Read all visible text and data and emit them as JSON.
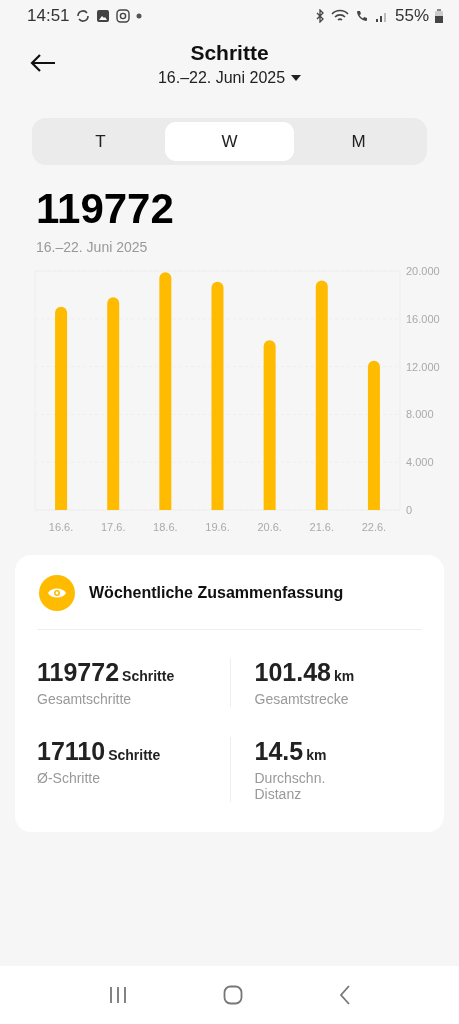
{
  "status_bar": {
    "time": "14:51",
    "battery": "55%"
  },
  "header": {
    "title": "Schritte",
    "period": "16.–22. Juni 2025"
  },
  "tabs": [
    {
      "label": "T",
      "selected": false
    },
    {
      "label": "W",
      "selected": true
    },
    {
      "label": "M",
      "selected": false
    }
  ],
  "total": {
    "value": "119772",
    "period": "16.–22. Juni 2025"
  },
  "chart_data": {
    "type": "bar",
    "categories": [
      "16.6.",
      "17.6.",
      "18.6.",
      "19.6.",
      "20.6.",
      "21.6.",
      "22.6."
    ],
    "series": [
      {
        "color": "#ffbb00",
        "values": [
          17.0,
          17.8,
          19.9,
          19.1,
          14.2,
          19.2,
          12.5
        ]
      }
    ],
    "ylim": [
      0,
      20
    ],
    "grid": true,
    "yticks": [
      {
        "value": 0,
        "label": "0"
      },
      {
        "value": 4,
        "label": "4.000"
      },
      {
        "value": 8,
        "label": "8.000"
      },
      {
        "value": 12,
        "label": "12.000"
      },
      {
        "value": 16,
        "label": "16.000"
      },
      {
        "value": 20,
        "label": "20.000"
      }
    ]
  },
  "summary": {
    "title": "Wöchentliche Zusammenfassung",
    "stats": [
      {
        "value": "119772",
        "unit": "Schritte",
        "label": "Gesamtschritte"
      },
      {
        "value": "101.48",
        "unit": "km",
        "label": "Gesamtstrecke"
      },
      {
        "value": "17110",
        "unit": "Schritte",
        "label": "Ø-Schritte"
      },
      {
        "value": "14.5",
        "unit": "km",
        "label": "Durchschn. Distanz"
      }
    ]
  }
}
